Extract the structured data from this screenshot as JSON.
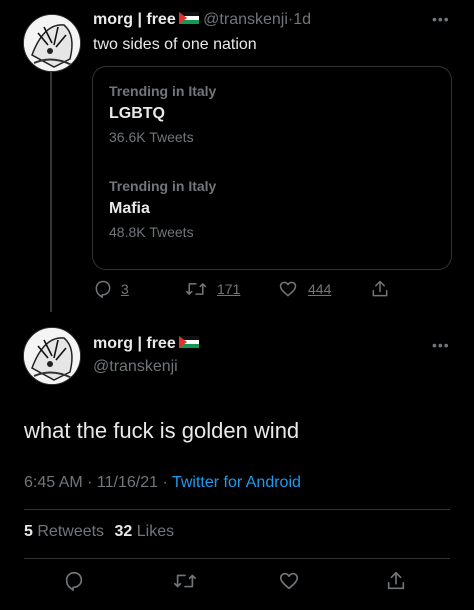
{
  "tweet1": {
    "display_name": "morg | free",
    "handle": "@transkenji",
    "sep": "·",
    "time": "1d",
    "text": "two sides of one nation",
    "cards": [
      {
        "label": "Trending in Italy",
        "topic": "LGBTQ",
        "count": "36.6K Tweets"
      },
      {
        "label": "Trending in Italy",
        "topic": "Mafia",
        "count": "48.8K Tweets"
      }
    ],
    "actions": {
      "replies": "3",
      "retweets": "171",
      "likes": "444"
    }
  },
  "tweet2": {
    "display_name": "morg | free",
    "handle": "@transkenji",
    "text": "what the fuck is golden wind",
    "meta_time": "6:45 AM · 11/16/21 · ",
    "source": "Twitter for Android",
    "retweets_count": "5",
    "retweets_label": "Retweets",
    "likes_count": "32",
    "likes_label": "Likes"
  },
  "icons": [
    "reply-icon",
    "retweet-icon",
    "like-icon",
    "share-icon",
    "more-icon"
  ],
  "colors": {
    "background": "#000000",
    "text": "#e7e9ea",
    "muted": "#71767b",
    "link": "#1d9bf0",
    "border": "#2f3336"
  }
}
